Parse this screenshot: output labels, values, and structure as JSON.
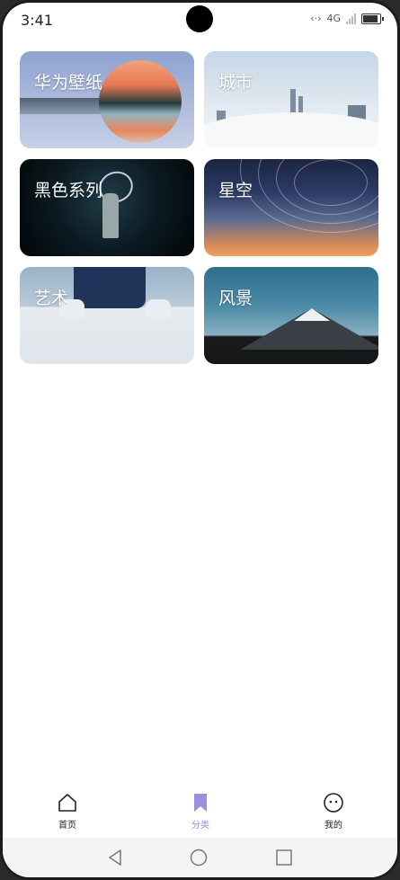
{
  "status": {
    "time": "3:41",
    "network": "4G"
  },
  "categories": [
    {
      "label": "华为壁纸"
    },
    {
      "label": "城市"
    },
    {
      "label": "黑色系列"
    },
    {
      "label": "星空"
    },
    {
      "label": "艺术"
    },
    {
      "label": "风景"
    }
  ],
  "tabs": {
    "home": "首页",
    "category": "分类",
    "mine": "我的",
    "active": "category",
    "active_color": "#9a8fe0"
  },
  "icons": [
    "home-icon",
    "bookmark-icon",
    "profile-face-icon",
    "back-icon",
    "home-circle-icon",
    "recents-icon"
  ]
}
